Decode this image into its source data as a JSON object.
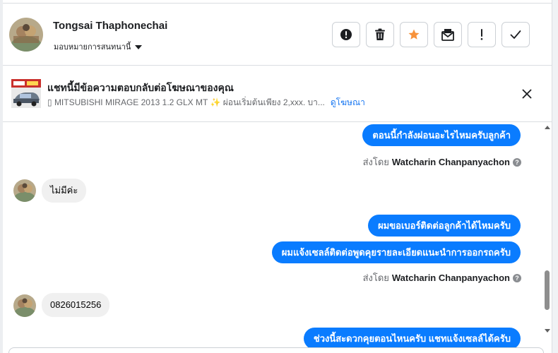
{
  "header": {
    "contact_name": "Tongsai Thaphonechai",
    "assign_label": "มอบหมายการสนทนานี้",
    "actions": [
      {
        "icon": "alert-circle-icon",
        "name": "mark-spam-button"
      },
      {
        "icon": "trash-icon",
        "name": "delete-button"
      },
      {
        "icon": "star-icon",
        "name": "star-button"
      },
      {
        "icon": "mail-unread-icon",
        "name": "mark-unread-button"
      },
      {
        "icon": "exclamation-icon",
        "name": "follow-up-button"
      },
      {
        "icon": "check-icon",
        "name": "mark-done-button"
      }
    ]
  },
  "ad_banner": {
    "title": "แชทนี้มีข้อความตอบกลับต่อโฆษณาของคุณ",
    "subtitle": "▯ MITSUBISHI MIRAGE 2013 1.2 GLX MT ✨ ผ่อนเริ่มต้นเพียง 2,xxx. บา...",
    "link_label": "ดูโฆษณา"
  },
  "messages": {
    "m1": "ตอนนี้กำลังผ่อนอะไรไหมครับลูกค้า",
    "sent_by_prefix": "ส่งโดย",
    "sender": "Watcharin Chanpanyachon",
    "m2": "ไม่มีค่ะ",
    "m3": "ผมขอเบอร์ติดต่อลูกค้าได้ไหมครับ",
    "m4": "ผมแจ้งเซลล์ติดต่อพูดคุยรายละเอียดแนะนำการออกรถครับ",
    "m5": "0826015256",
    "m6": "ช่วงนี้สะดวกคุยตอนไหนครับ แชทแจ้งเซลล์ได้ครับ"
  },
  "colors": {
    "accent": "#0a7cff",
    "star": "#f7923b",
    "incoming_bubble": "#f0f0f0"
  }
}
